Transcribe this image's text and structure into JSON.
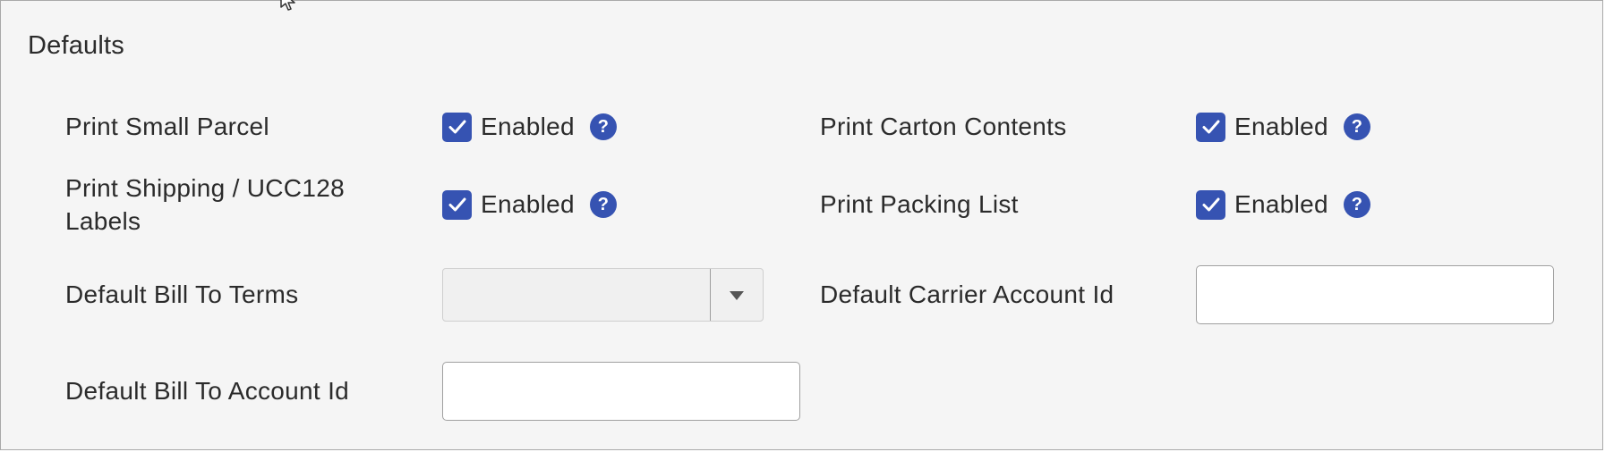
{
  "section": {
    "title": "Defaults"
  },
  "settings": {
    "print_small_parcel": {
      "label": "Print Small Parcel",
      "checked": true,
      "state_label": "Enabled"
    },
    "print_carton_contents": {
      "label": "Print Carton Contents",
      "checked": true,
      "state_label": "Enabled"
    },
    "print_shipping_labels": {
      "label_line1": "Print Shipping / UCC128",
      "label_line2": "Labels",
      "checked": true,
      "state_label": "Enabled"
    },
    "print_packing_list": {
      "label": "Print Packing List",
      "checked": true,
      "state_label": "Enabled"
    }
  },
  "fields": {
    "default_bill_to_terms": {
      "label": "Default Bill To Terms",
      "value": ""
    },
    "default_carrier_account_id": {
      "label": "Default Carrier Account Id",
      "value": ""
    },
    "default_bill_to_account_id": {
      "label": "Default Bill To Account Id",
      "value": ""
    }
  },
  "icons": {
    "help": "?",
    "checkbox": "checkmark-icon",
    "dropdown": "caret-down-icon",
    "cursor": "mouse-pointer-icon"
  },
  "colors": {
    "accent": "#3653b2",
    "panel_bg": "#f5f5f5",
    "text": "#2b2b2b",
    "border": "#a9a9a9"
  }
}
